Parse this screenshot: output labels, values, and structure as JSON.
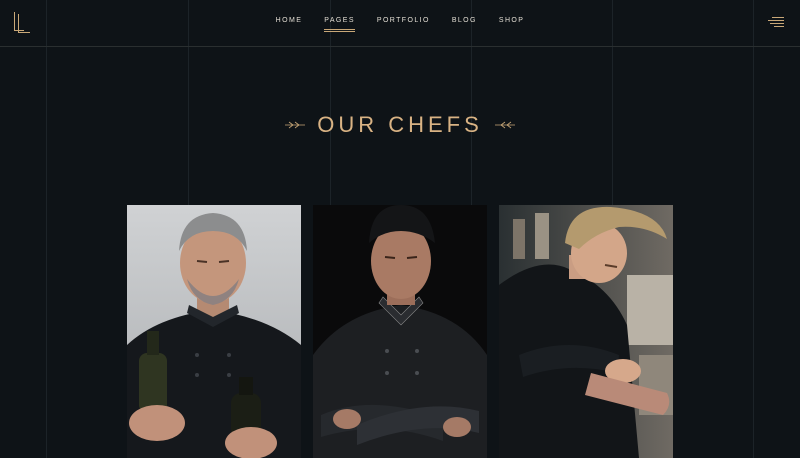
{
  "nav": {
    "items": [
      {
        "label": "HOME",
        "active": false
      },
      {
        "label": "PAGES",
        "active": true
      },
      {
        "label": "PORTFOLIO",
        "active": false
      },
      {
        "label": "BLOG",
        "active": false
      },
      {
        "label": "SHOP",
        "active": false
      }
    ]
  },
  "section": {
    "title": "OUR CHEFS"
  },
  "chefs": [
    {
      "photo": "chef-with-wine-bottles"
    },
    {
      "photo": "chef-with-crossed-arms"
    },
    {
      "photo": "chef-preparing-food"
    }
  ],
  "colors": {
    "background": "#0e1317",
    "accent": "#d9b384",
    "grid": "#1c2328"
  }
}
